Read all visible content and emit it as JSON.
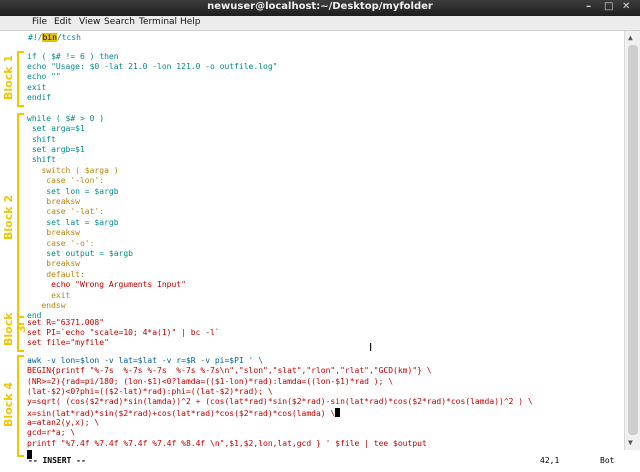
{
  "window": {
    "title": "newuser@localhost:~/Desktop/myfolder",
    "controls": [
      "–",
      "□",
      "✕"
    ]
  },
  "menu": [
    "File",
    "Edit",
    "View",
    "Search",
    "Terminal",
    "Help"
  ],
  "annotations": {
    "block1": "Block 1",
    "block2": "Block 2",
    "block3": "Block 3",
    "block4": "Block 4"
  },
  "code": {
    "shebang_pre": "#!/",
    "shebang_hl": "bin",
    "shebang_post": "/tcsh",
    "b1": [
      "if ( $# != 6 ) then",
      "echo \"Usage: $0 -lat 21.0 -lon 121.0 -o outfile.log\"",
      "echo \"\"",
      "exit",
      "endif"
    ],
    "b2": [
      "while ( $# > 0 )",
      " set arga=$1",
      " shift",
      " set argb=$1",
      " shift",
      "   switch ( $arga )",
      "    case '-lon':",
      "    set lon = $argb",
      "    breaksw",
      "    case '-lat':",
      "    set lat = $argb",
      "    breaksw",
      "    case '-o':",
      "    set output = $argb",
      "    breaksw",
      "    default:",
      "     echo \"Wrong Arguments Input\"",
      "     exit",
      "   endsw",
      "end"
    ],
    "b3": [
      "set R=\"6371.008\"",
      "set PI=`echo \"scale=10; 4*a(1)\" | bc -l`",
      "set file=\"myfile\""
    ],
    "b4": [
      "awk -v lon=$lon -v lat=$lat -v r=$R -v pi=$PI ' \\",
      "BEGIN{printf \"%-7s  %-7s %-7s  %-7s %-7s\\n\",\"slon\",\"slat\",\"rlon\",\"rlat\",\"GCD(km)\"} \\",
      "(NR>=2){rad=pi/180; (lon-$1)<0?lamda=(($1-lon)*rad):lamda=((lon-$1)*rad ); \\",
      "(lat-$2)<0?phi=(($2-lat)*rad):phi=((lat-$2)*rad); \\",
      "y=sqrt( (cos($2*rad)*sin(lamda))^2 + (cos(lat*rad)*sin($2*rad)-sin(lat*rad)*cos($2*rad)*cos(lamda))^2 ) \\",
      "x=sin(lat*rad)*sin($2*rad)+cos(lat*rad)*cos($2*rad)*cos(lamda) \\",
      "a=atan2(y,x); \\",
      "gcd=r*a; \\",
      "printf \"%7.4f %7.4f %7.4f %7.4f %8.4f \\n\",$1,$2,lon,lat,gcd } ' $file | tee $output"
    ]
  },
  "status": {
    "mode": "-- INSERT --",
    "position": "42,1",
    "scroll": "Bot"
  }
}
